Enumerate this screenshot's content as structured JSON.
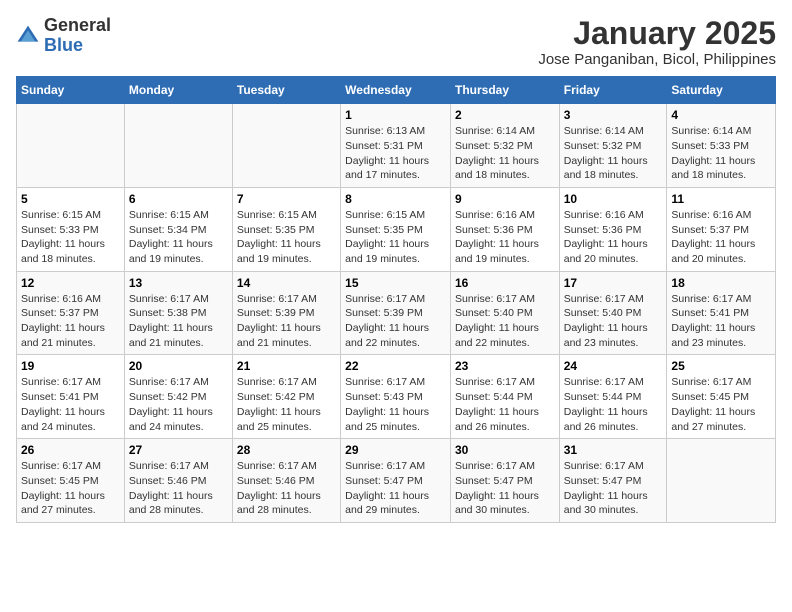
{
  "logo": {
    "general": "General",
    "blue": "Blue"
  },
  "title": "January 2025",
  "subtitle": "Jose Panganiban, Bicol, Philippines",
  "days_of_week": [
    "Sunday",
    "Monday",
    "Tuesday",
    "Wednesday",
    "Thursday",
    "Friday",
    "Saturday"
  ],
  "weeks": [
    [
      {
        "day": "",
        "sunrise": "",
        "sunset": "",
        "daylight": ""
      },
      {
        "day": "",
        "sunrise": "",
        "sunset": "",
        "daylight": ""
      },
      {
        "day": "",
        "sunrise": "",
        "sunset": "",
        "daylight": ""
      },
      {
        "day": "1",
        "sunrise": "Sunrise: 6:13 AM",
        "sunset": "Sunset: 5:31 PM",
        "daylight": "Daylight: 11 hours and 17 minutes."
      },
      {
        "day": "2",
        "sunrise": "Sunrise: 6:14 AM",
        "sunset": "Sunset: 5:32 PM",
        "daylight": "Daylight: 11 hours and 18 minutes."
      },
      {
        "day": "3",
        "sunrise": "Sunrise: 6:14 AM",
        "sunset": "Sunset: 5:32 PM",
        "daylight": "Daylight: 11 hours and 18 minutes."
      },
      {
        "day": "4",
        "sunrise": "Sunrise: 6:14 AM",
        "sunset": "Sunset: 5:33 PM",
        "daylight": "Daylight: 11 hours and 18 minutes."
      }
    ],
    [
      {
        "day": "5",
        "sunrise": "Sunrise: 6:15 AM",
        "sunset": "Sunset: 5:33 PM",
        "daylight": "Daylight: 11 hours and 18 minutes."
      },
      {
        "day": "6",
        "sunrise": "Sunrise: 6:15 AM",
        "sunset": "Sunset: 5:34 PM",
        "daylight": "Daylight: 11 hours and 19 minutes."
      },
      {
        "day": "7",
        "sunrise": "Sunrise: 6:15 AM",
        "sunset": "Sunset: 5:35 PM",
        "daylight": "Daylight: 11 hours and 19 minutes."
      },
      {
        "day": "8",
        "sunrise": "Sunrise: 6:15 AM",
        "sunset": "Sunset: 5:35 PM",
        "daylight": "Daylight: 11 hours and 19 minutes."
      },
      {
        "day": "9",
        "sunrise": "Sunrise: 6:16 AM",
        "sunset": "Sunset: 5:36 PM",
        "daylight": "Daylight: 11 hours and 19 minutes."
      },
      {
        "day": "10",
        "sunrise": "Sunrise: 6:16 AM",
        "sunset": "Sunset: 5:36 PM",
        "daylight": "Daylight: 11 hours and 20 minutes."
      },
      {
        "day": "11",
        "sunrise": "Sunrise: 6:16 AM",
        "sunset": "Sunset: 5:37 PM",
        "daylight": "Daylight: 11 hours and 20 minutes."
      }
    ],
    [
      {
        "day": "12",
        "sunrise": "Sunrise: 6:16 AM",
        "sunset": "Sunset: 5:37 PM",
        "daylight": "Daylight: 11 hours and 21 minutes."
      },
      {
        "day": "13",
        "sunrise": "Sunrise: 6:17 AM",
        "sunset": "Sunset: 5:38 PM",
        "daylight": "Daylight: 11 hours and 21 minutes."
      },
      {
        "day": "14",
        "sunrise": "Sunrise: 6:17 AM",
        "sunset": "Sunset: 5:39 PM",
        "daylight": "Daylight: 11 hours and 21 minutes."
      },
      {
        "day": "15",
        "sunrise": "Sunrise: 6:17 AM",
        "sunset": "Sunset: 5:39 PM",
        "daylight": "Daylight: 11 hours and 22 minutes."
      },
      {
        "day": "16",
        "sunrise": "Sunrise: 6:17 AM",
        "sunset": "Sunset: 5:40 PM",
        "daylight": "Daylight: 11 hours and 22 minutes."
      },
      {
        "day": "17",
        "sunrise": "Sunrise: 6:17 AM",
        "sunset": "Sunset: 5:40 PM",
        "daylight": "Daylight: 11 hours and 23 minutes."
      },
      {
        "day": "18",
        "sunrise": "Sunrise: 6:17 AM",
        "sunset": "Sunset: 5:41 PM",
        "daylight": "Daylight: 11 hours and 23 minutes."
      }
    ],
    [
      {
        "day": "19",
        "sunrise": "Sunrise: 6:17 AM",
        "sunset": "Sunset: 5:41 PM",
        "daylight": "Daylight: 11 hours and 24 minutes."
      },
      {
        "day": "20",
        "sunrise": "Sunrise: 6:17 AM",
        "sunset": "Sunset: 5:42 PM",
        "daylight": "Daylight: 11 hours and 24 minutes."
      },
      {
        "day": "21",
        "sunrise": "Sunrise: 6:17 AM",
        "sunset": "Sunset: 5:42 PM",
        "daylight": "Daylight: 11 hours and 25 minutes."
      },
      {
        "day": "22",
        "sunrise": "Sunrise: 6:17 AM",
        "sunset": "Sunset: 5:43 PM",
        "daylight": "Daylight: 11 hours and 25 minutes."
      },
      {
        "day": "23",
        "sunrise": "Sunrise: 6:17 AM",
        "sunset": "Sunset: 5:44 PM",
        "daylight": "Daylight: 11 hours and 26 minutes."
      },
      {
        "day": "24",
        "sunrise": "Sunrise: 6:17 AM",
        "sunset": "Sunset: 5:44 PM",
        "daylight": "Daylight: 11 hours and 26 minutes."
      },
      {
        "day": "25",
        "sunrise": "Sunrise: 6:17 AM",
        "sunset": "Sunset: 5:45 PM",
        "daylight": "Daylight: 11 hours and 27 minutes."
      }
    ],
    [
      {
        "day": "26",
        "sunrise": "Sunrise: 6:17 AM",
        "sunset": "Sunset: 5:45 PM",
        "daylight": "Daylight: 11 hours and 27 minutes."
      },
      {
        "day": "27",
        "sunrise": "Sunrise: 6:17 AM",
        "sunset": "Sunset: 5:46 PM",
        "daylight": "Daylight: 11 hours and 28 minutes."
      },
      {
        "day": "28",
        "sunrise": "Sunrise: 6:17 AM",
        "sunset": "Sunset: 5:46 PM",
        "daylight": "Daylight: 11 hours and 28 minutes."
      },
      {
        "day": "29",
        "sunrise": "Sunrise: 6:17 AM",
        "sunset": "Sunset: 5:47 PM",
        "daylight": "Daylight: 11 hours and 29 minutes."
      },
      {
        "day": "30",
        "sunrise": "Sunrise: 6:17 AM",
        "sunset": "Sunset: 5:47 PM",
        "daylight": "Daylight: 11 hours and 30 minutes."
      },
      {
        "day": "31",
        "sunrise": "Sunrise: 6:17 AM",
        "sunset": "Sunset: 5:47 PM",
        "daylight": "Daylight: 11 hours and 30 minutes."
      },
      {
        "day": "",
        "sunrise": "",
        "sunset": "",
        "daylight": ""
      }
    ]
  ]
}
